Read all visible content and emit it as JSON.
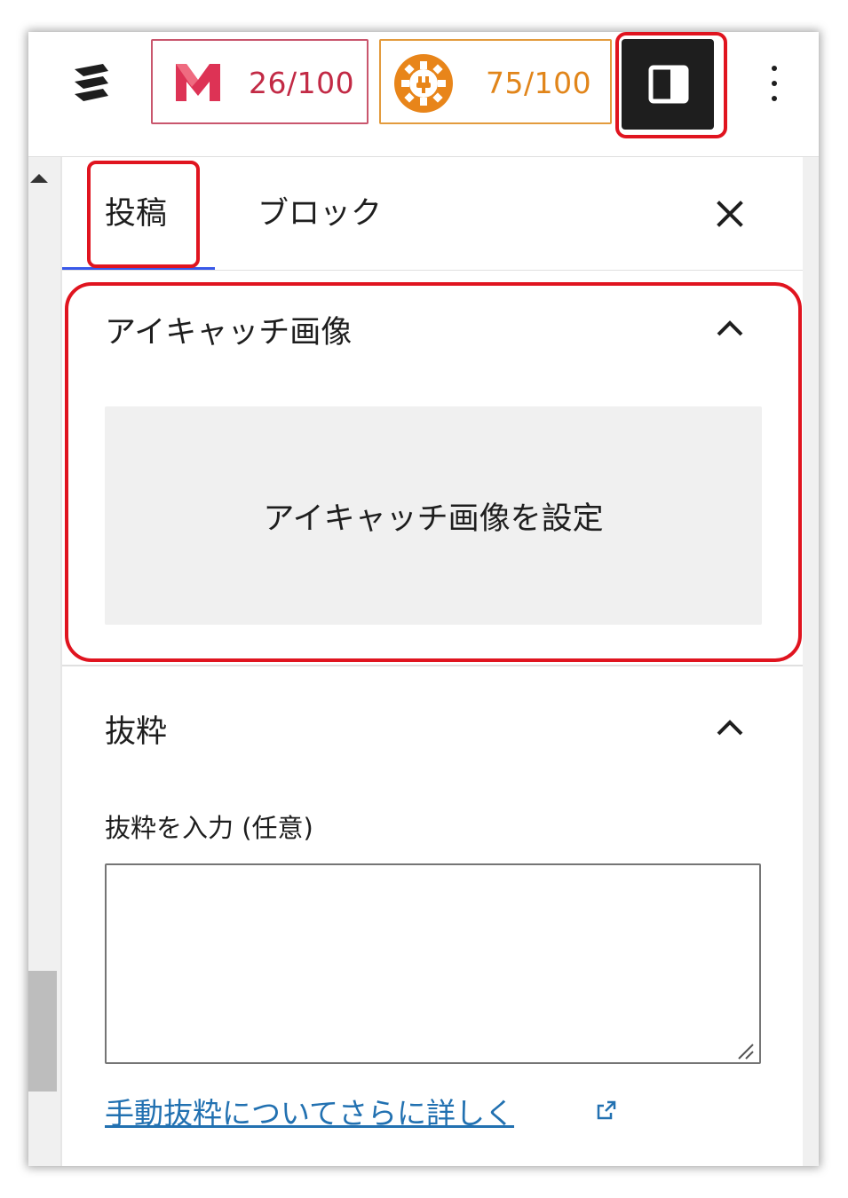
{
  "toolbar": {
    "seo_score": "26/100",
    "seo_icon": "seo-m-icon",
    "performance_score": "75/100",
    "performance_icon": "gear-plug-icon",
    "sidebar_toggle_icon": "sidebar-panel-icon",
    "more_icon": "vertical-ellipsis-icon",
    "logo_icon": "s-logo-icon"
  },
  "tabs": {
    "post_label": "投稿",
    "block_label": "ブロック",
    "active": "post"
  },
  "featured_image": {
    "title": "アイキャッチ画像",
    "button_label": "アイキャッチ画像を設定"
  },
  "excerpt": {
    "title": "抜粋",
    "input_label": "抜粋を入力 (任意)",
    "value": "",
    "help_link": "手動抜粋についてさらに詳しく"
  },
  "colors": {
    "seo_accent": "#c22a45",
    "performance_accent": "#e1851a",
    "highlight": "#e0141f",
    "link": "#2271b1",
    "active_tab": "#3858e9"
  }
}
